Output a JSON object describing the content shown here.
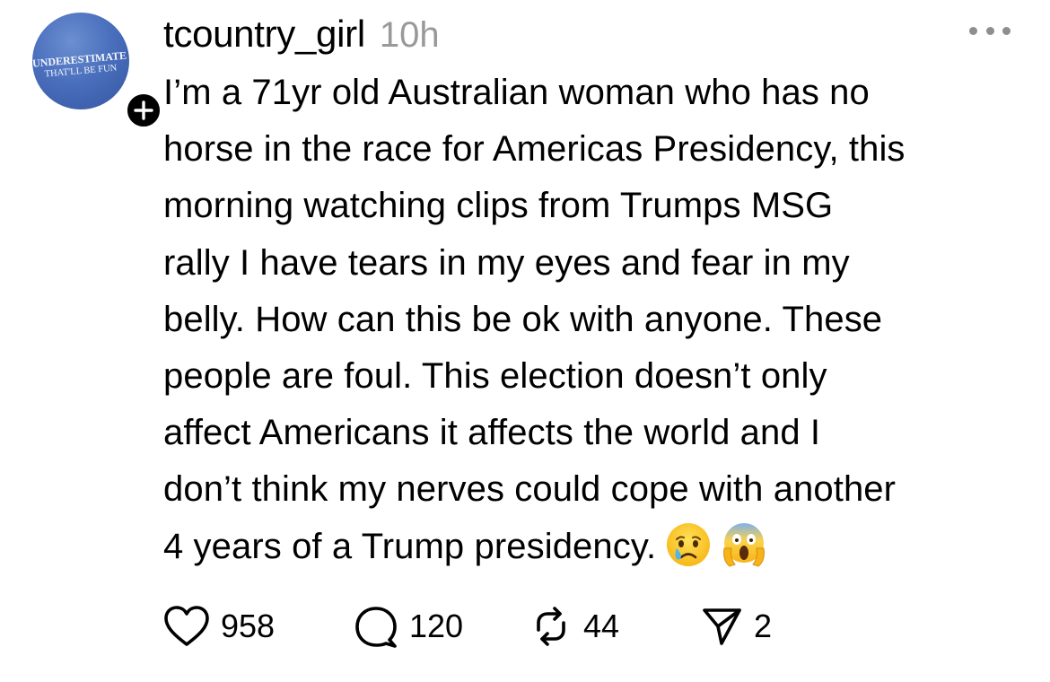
{
  "post": {
    "avatar": {
      "shirt_line1": "UNDERESTIMATE ME",
      "shirt_line2": "THAT'LL BE FUN",
      "follow_icon": "plus-icon"
    },
    "username": "tcountry_girl",
    "timestamp": "10h",
    "menu_icon": "more-horizontal-icon",
    "text_lines": [
      "I’m a 71yr old Australian woman who has no",
      "horse in the race for Americas Presidency, this",
      "morning watching clips from Trumps MSG",
      "rally I have tears in my eyes and fear in my",
      "belly. How can this be ok with anyone. These",
      "people are foul. This election doesn’t only",
      "affect Americans it affects the world and I",
      "don’t think my nerves could cope with another",
      "4 years of a Trump presidency."
    ],
    "emojis": [
      "crying-face-emoji",
      "screaming-face-emoji"
    ],
    "actions": {
      "likes": "958",
      "replies": "120",
      "reposts": "44",
      "shares": "2"
    }
  },
  "colors": {
    "text": "#000000",
    "muted": "#999999",
    "avatar_blue": "#4a6fbd"
  }
}
